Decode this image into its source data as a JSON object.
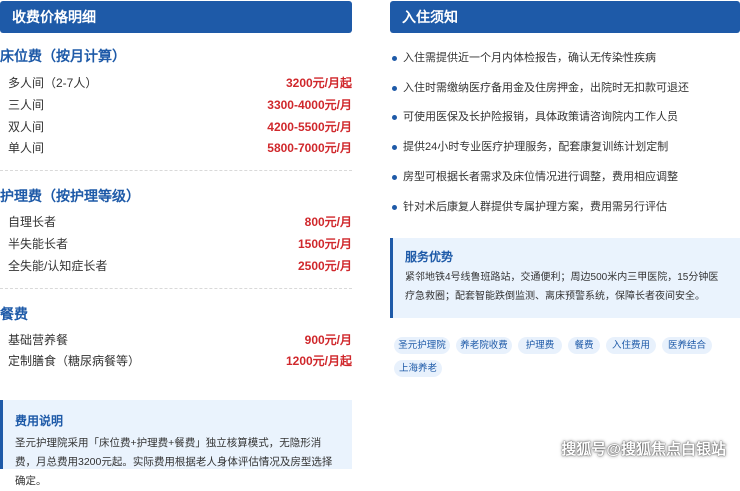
{
  "left_header": "收费价格明细",
  "right_header": "入住须知",
  "bed_fee": {
    "title": "床位费（按月计算）",
    "rows": [
      {
        "label": "多人间（2-7人）",
        "price": "3200元/月起"
      },
      {
        "label": "三人间",
        "price": "3300-4000元/月"
      },
      {
        "label": "双人间",
        "price": "4200-5500元/月"
      },
      {
        "label": "单人间",
        "price": "5800-7000元/月"
      }
    ]
  },
  "care_fee": {
    "title": "护理费（按护理等级）",
    "rows": [
      {
        "label": "自理长者",
        "price": "800元/月"
      },
      {
        "label": "半失能长者",
        "price": "1500元/月"
      },
      {
        "label": "全失能/认知症长者",
        "price": "2500元/月"
      }
    ]
  },
  "meal_fee": {
    "title": "餐费",
    "rows": [
      {
        "label": "基础营养餐",
        "price": "900元/月"
      },
      {
        "label": "定制膳食（糖尿病餐等）",
        "price": "1200元/月起"
      }
    ]
  },
  "fee_note": {
    "title": "费用说明",
    "body": "圣元护理院采用「床位费+护理费+餐费」独立核算模式，无隐形消费，月总费用3200元起。实际费用根据老人身体评估情况及房型选择确定。"
  },
  "notices": [
    "入住需提供近一个月内体检报告，确认无传染性疾病",
    "入住时需缴纳医疗备用金及住房押金，出院时无扣款可退还",
    "可使用医保及长护险报销，具体政策请咨询院内工作人员",
    "提供24小时专业医疗护理服务，配套康复训练计划定制",
    "房型可根据长者需求及床位情况进行调整，费用相应调整",
    "针对术后康复人群提供专属护理方案，费用需另行评估"
  ],
  "advantage": {
    "title": "服务优势",
    "body": "紧邻地铁4号线鲁班路站，交通便利；周边500米内三甲医院，15分钟医疗急救圈；配套智能跌倒监测、离床预警系统，保障长者夜间安全。"
  },
  "tags": [
    "圣元护理院",
    "养老院收费",
    "护理费",
    "餐费",
    "入住费用",
    "医养结合",
    "上海养老"
  ],
  "watermark": "搜狐号@搜狐焦点白银站",
  "colors": {
    "primary": "#1e5aa8",
    "price": "#d0282c",
    "panel_bg": "#eaf3fd"
  }
}
